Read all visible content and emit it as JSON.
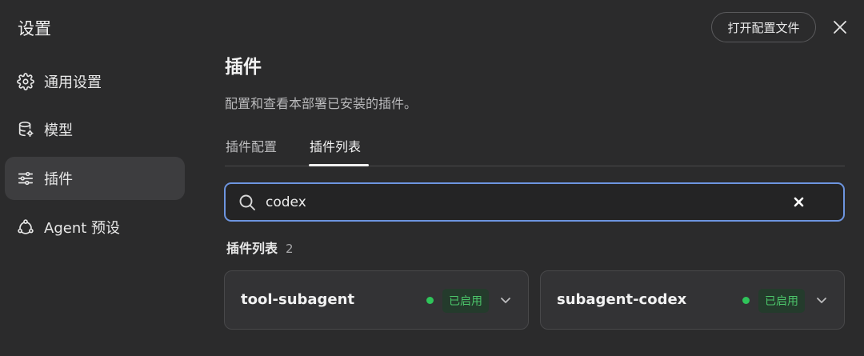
{
  "sidebar": {
    "title": "设置",
    "items": [
      {
        "label": "通用设置",
        "icon": "gear-icon"
      },
      {
        "label": "模型",
        "icon": "database-icon"
      },
      {
        "label": "插件",
        "icon": "sliders-icon",
        "active": true
      },
      {
        "label": "Agent 预设",
        "icon": "agent-network-icon"
      }
    ]
  },
  "header": {
    "open_config_label": "打开配置文件"
  },
  "main": {
    "title": "插件",
    "description": "配置和查看本部署已安装的插件。",
    "tabs": [
      {
        "label": "插件配置"
      },
      {
        "label": "插件列表",
        "active": true
      }
    ],
    "search": {
      "value": "codex"
    },
    "list": {
      "title": "插件列表",
      "count": "2",
      "plugins": [
        {
          "name": "tool-subagent",
          "status": "已启用"
        },
        {
          "name": "subagent-codex",
          "status": "已启用"
        }
      ]
    }
  },
  "colors": {
    "background": "#2b2b2c",
    "accent_focus": "#6d95e0",
    "status_enabled": "#2fc45a"
  }
}
